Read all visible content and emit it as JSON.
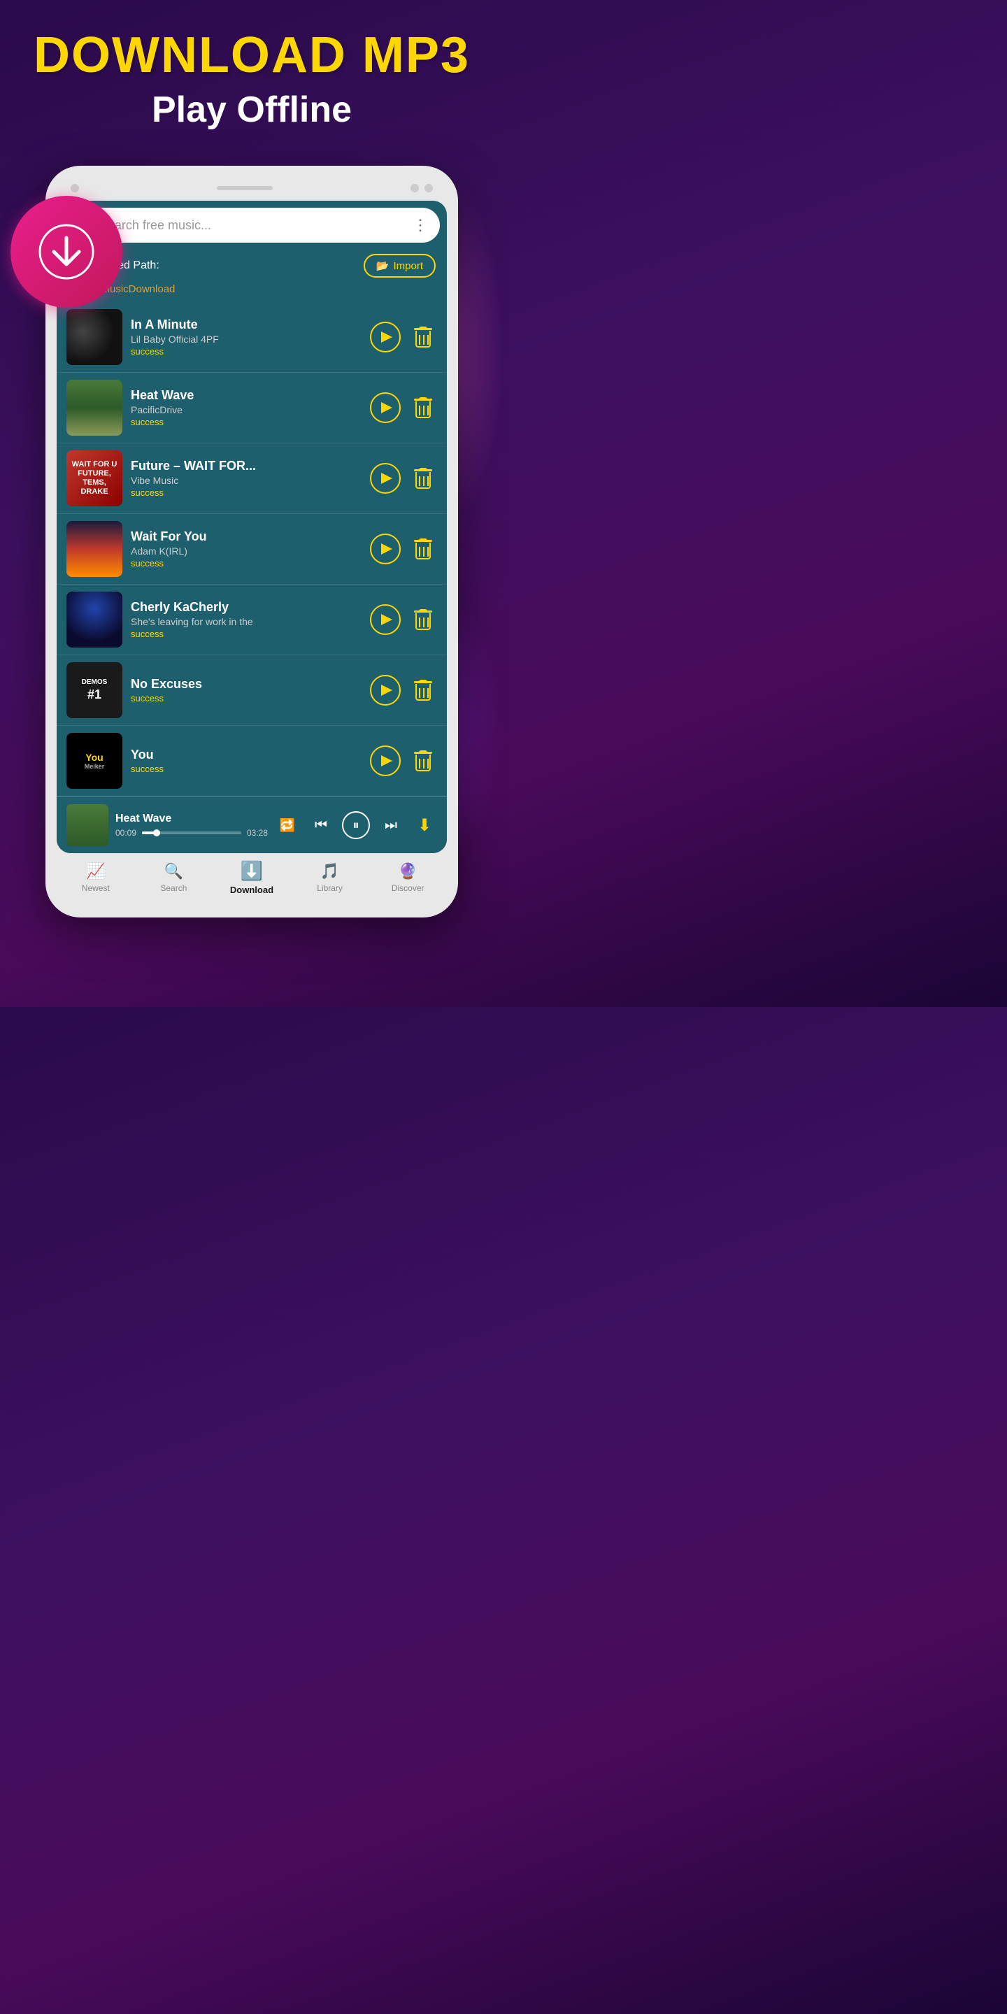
{
  "header": {
    "title_line1": "DOWNLOAD MP3",
    "title_line2": "Play Offline"
  },
  "search": {
    "placeholder": "Search free music...",
    "more_icon": "⋮"
  },
  "path_section": {
    "label": "Downloaded Path:",
    "path": "/Music/MusicDownload",
    "import_button": "Import"
  },
  "songs": [
    {
      "title": "In A Minute",
      "artist": "Lil Baby Official 4PF",
      "status": "success",
      "thumb_type": "in-a-minute"
    },
    {
      "title": "Heat Wave",
      "artist": "PacificDrive",
      "status": "success",
      "thumb_type": "heat-wave"
    },
    {
      "title": "Future – WAIT FOR...",
      "artist": "Vibe Music",
      "status": "success",
      "thumb_type": "wait-for"
    },
    {
      "title": "Wait For You",
      "artist": "Adam K(IRL)",
      "status": "success",
      "thumb_type": "wait-sunset"
    },
    {
      "title": "Cherly KaCherly",
      "artist": "She's leaving for work in the",
      "status": "success",
      "thumb_type": "cherly"
    },
    {
      "title": "No Excuses",
      "artist": "",
      "status": "success",
      "thumb_type": "demos"
    },
    {
      "title": "You",
      "artist": "",
      "status": "success",
      "thumb_type": "you"
    }
  ],
  "now_playing": {
    "title": "Heat Wave",
    "time_current": "00:09",
    "time_total": "03:28"
  },
  "bottom_nav": {
    "items": [
      {
        "label": "Newest",
        "icon": "📈",
        "active": false
      },
      {
        "label": "Search",
        "icon": "🔍",
        "active": false
      },
      {
        "label": "Download",
        "icon": "⬇️",
        "active": true
      },
      {
        "label": "Library",
        "icon": "🎵",
        "active": false
      },
      {
        "label": "Discover",
        "icon": "🔮",
        "active": false
      }
    ]
  },
  "colors": {
    "yellow": "#FFD700",
    "screen_bg": "#1e5f6e",
    "header_bg": "#2a0a4a",
    "accent_pink": "#e91e8c",
    "white": "#ffffff"
  }
}
